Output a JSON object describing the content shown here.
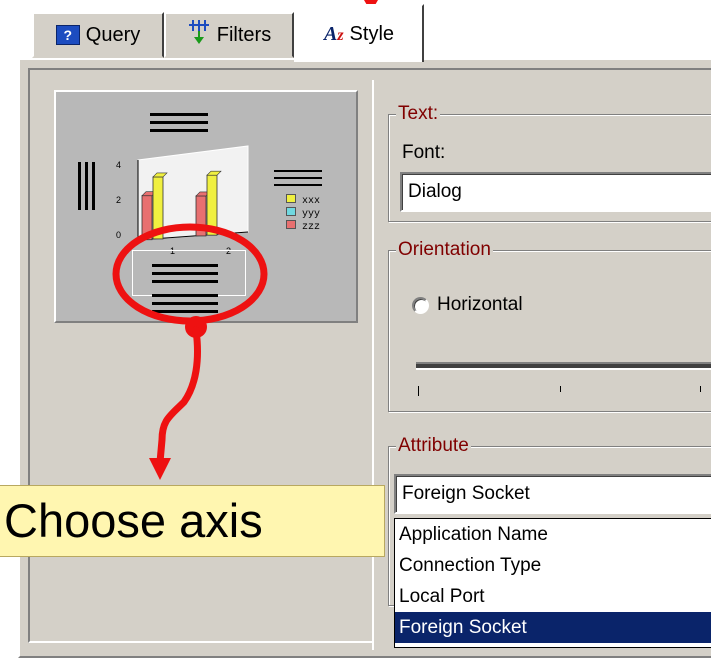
{
  "tabs": [
    {
      "label": "Query",
      "icon": "query-icon",
      "active": false
    },
    {
      "label": "Filters",
      "icon": "filters-icon",
      "active": false
    },
    {
      "label": "Style",
      "icon": "style-icon",
      "active": true
    }
  ],
  "text_group": {
    "legend": "Text:",
    "font_label": "Font:",
    "font_value": "Dialog"
  },
  "orientation_group": {
    "legend": "Orientation",
    "horizontal_label": "Horizontal"
  },
  "attribute_group": {
    "legend": "Attribute",
    "selected_value": "Foreign Socket",
    "options": [
      "Application Name",
      "Connection Type",
      "Local Port",
      "Foreign Socket"
    ],
    "highlighted_option": "Foreign Socket"
  },
  "preview": {
    "y_ticks": [
      "0",
      "2",
      "4"
    ],
    "x_ticks": [
      "1",
      "2"
    ],
    "legend_items": [
      "xxx",
      "yyy",
      "zzz"
    ],
    "bar_colors": [
      "#e87070",
      "#f0f040",
      "#70d8e0"
    ]
  },
  "annotation": {
    "text": ".Choose axis",
    "color": "#ee1111"
  },
  "colors": {
    "dialog_bg": "#d4d0c8",
    "legend_text": "#800000",
    "selection": "#0a246a",
    "callout_bg": "#fff6b0"
  }
}
